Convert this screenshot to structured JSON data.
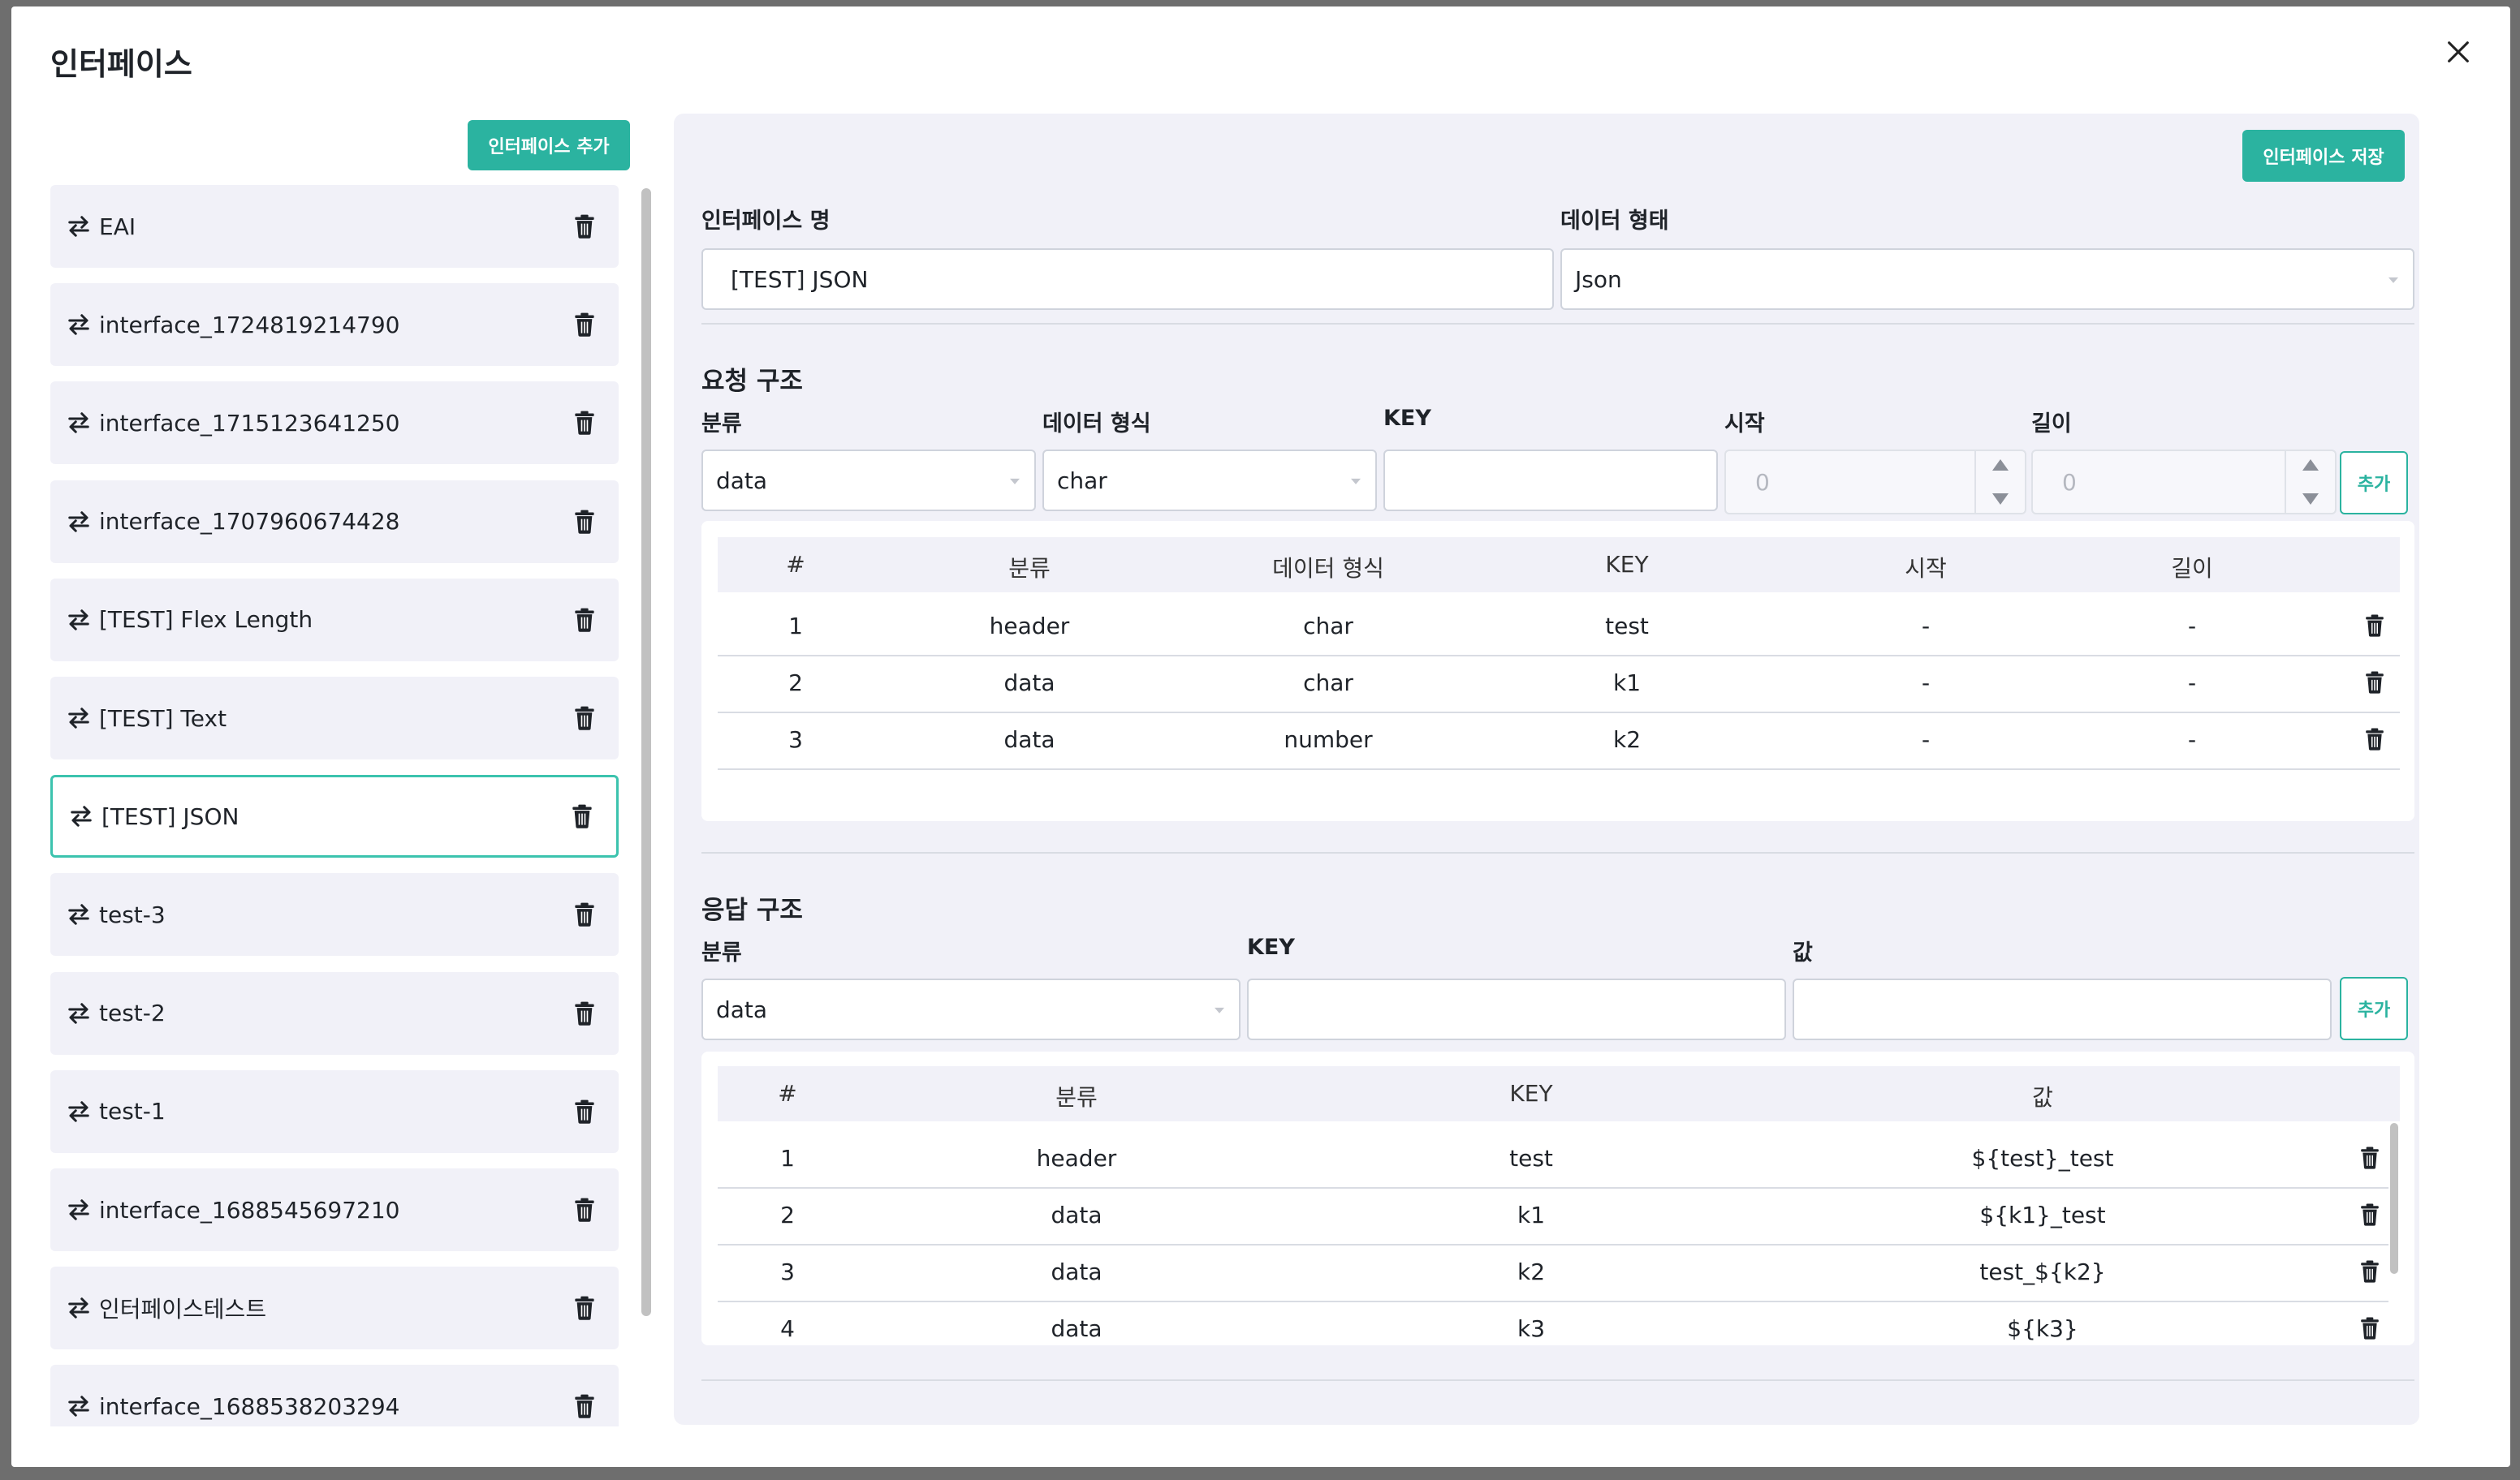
{
  "modal": {
    "title": "인터페이스",
    "add_interface_label": "인터페이스 추가",
    "save_interface_label": "인터페이스 저장"
  },
  "interfaces": [
    {
      "name": "EAI",
      "selected": false
    },
    {
      "name": "interface_1724819214790",
      "selected": false
    },
    {
      "name": "interface_1715123641250",
      "selected": false
    },
    {
      "name": "interface_1707960674428",
      "selected": false
    },
    {
      "name": "[TEST] Flex Length",
      "selected": false
    },
    {
      "name": "[TEST] Text",
      "selected": false
    },
    {
      "name": "[TEST] JSON",
      "selected": true
    },
    {
      "name": "test-3",
      "selected": false
    },
    {
      "name": "test-2",
      "selected": false
    },
    {
      "name": "test-1",
      "selected": false
    },
    {
      "name": "interface_1688545697210",
      "selected": false
    },
    {
      "name": "인터페이스테스트",
      "selected": false
    },
    {
      "name": "interface_1688538203294",
      "selected": false
    }
  ],
  "form": {
    "name_label": "인터페이스 명",
    "name_value": "[TEST] JSON",
    "type_label": "데이터 형태",
    "type_value": "Json"
  },
  "request": {
    "title": "요청 구조",
    "labels": {
      "category": "분류",
      "format": "데이터 형식",
      "key": "KEY",
      "start": "시작",
      "length": "길이"
    },
    "inputs": {
      "category": "data",
      "format": "char",
      "key": "",
      "start_placeholder": "0",
      "length_placeholder": "0"
    },
    "add_label": "추가",
    "table": {
      "headers": [
        "#",
        "분류",
        "데이터 형식",
        "KEY",
        "시작",
        "길이"
      ],
      "rows": [
        [
          "1",
          "header",
          "char",
          "test",
          "-",
          "-"
        ],
        [
          "2",
          "data",
          "char",
          "k1",
          "-",
          "-"
        ],
        [
          "3",
          "data",
          "number",
          "k2",
          "-",
          "-"
        ]
      ]
    }
  },
  "response": {
    "title": "응답 구조",
    "labels": {
      "category": "분류",
      "key": "KEY",
      "value": "값"
    },
    "inputs": {
      "category": "data",
      "key": "",
      "value": ""
    },
    "add_label": "추가",
    "table": {
      "headers": [
        "#",
        "분류",
        "KEY",
        "값"
      ],
      "rows": [
        [
          "1",
          "header",
          "test",
          "${test}_test"
        ],
        [
          "2",
          "data",
          "k1",
          "${k1}_test"
        ],
        [
          "3",
          "data",
          "k2",
          "test_${k2}"
        ],
        [
          "4",
          "data",
          "k3",
          "${k3}"
        ]
      ]
    }
  },
  "icons": {
    "close": "close-icon",
    "swap": "swap-icon",
    "trash": "trash-icon"
  },
  "colors": {
    "primary": "#2bb3a0",
    "panel_bg": "#f1f1f8",
    "selected_border": "#3cc3ae"
  }
}
